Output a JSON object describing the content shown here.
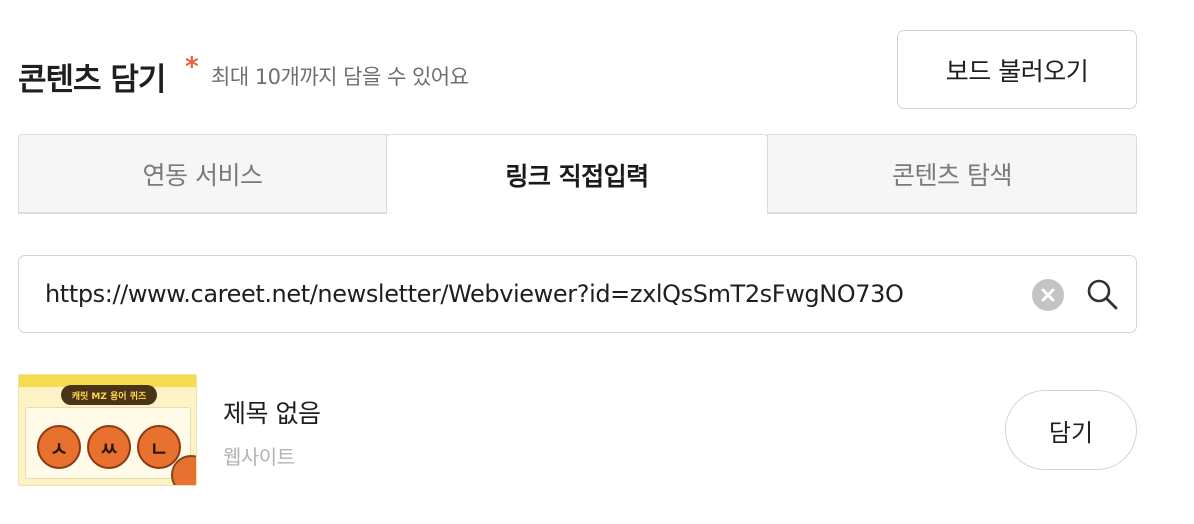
{
  "header": {
    "title": "콘텐츠 담기",
    "required_mark": "*",
    "hint": "최대 10개까지 담을 수 있어요",
    "load_board_label": "보드 불러오기"
  },
  "tabs": [
    {
      "label": "연동 서비스",
      "active": false
    },
    {
      "label": "링크 직접입력",
      "active": true
    },
    {
      "label": "콘텐츠 탐색",
      "active": false
    }
  ],
  "search": {
    "value": "https://www.careet.net/newsletter/Webviewer?id=zxlQsSmT2sFwgNO73O",
    "clear_icon": "clear-circle-icon",
    "search_icon": "magnifier-icon"
  },
  "result": {
    "title": "제목 없음",
    "type": "웹사이트",
    "add_label": "담기",
    "thumbnail": {
      "badge": "캐릿 MZ 용어 퀴즈",
      "letters": [
        "ㅅ",
        "ㅆ",
        "ㄴ"
      ]
    }
  },
  "colors": {
    "accent": "#e8603c",
    "border": "#d4d4d4",
    "muted": "#7a7a7a"
  }
}
